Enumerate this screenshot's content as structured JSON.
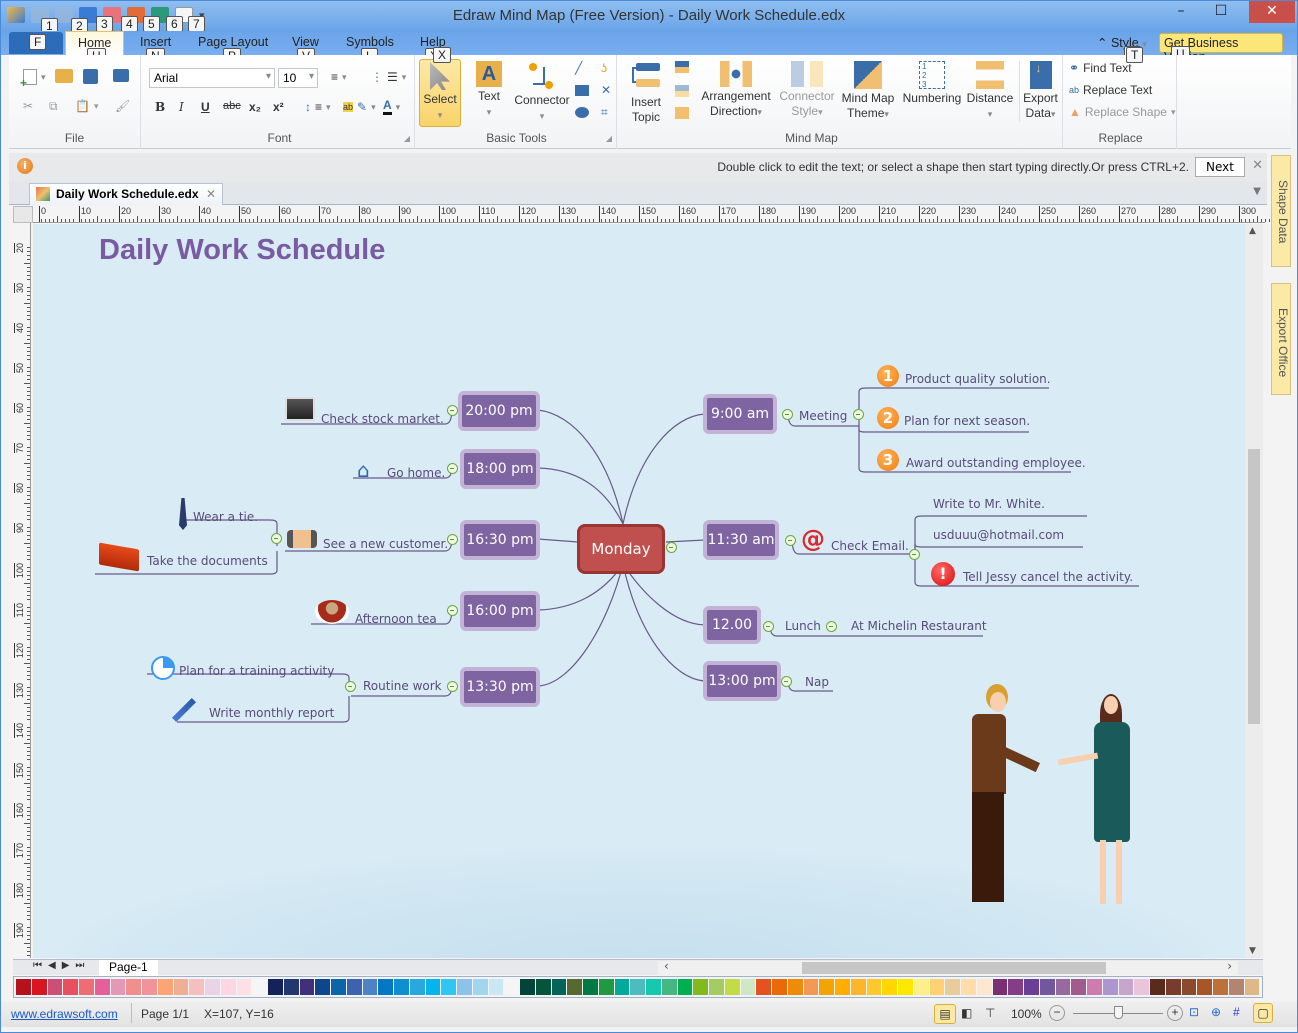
{
  "window": {
    "title": "Edraw Mind Map (Free Version) - Daily Work Schedule.edx",
    "minimize": "–",
    "maximize": "☐",
    "close": "✕"
  },
  "qat_keytips": [
    "1",
    "2",
    "3",
    "4",
    "5",
    "6",
    "7"
  ],
  "ribbon_tabs": [
    {
      "label": "F",
      "keytip": ""
    },
    {
      "label": "Home",
      "keytip": "H"
    },
    {
      "label": "Insert",
      "keytip": "N"
    },
    {
      "label": "Page Layout",
      "keytip": "P"
    },
    {
      "label": "View",
      "keytip": "V"
    },
    {
      "label": "Symbols",
      "keytip": "L"
    },
    {
      "label": "Help",
      "keytip": "X"
    }
  ],
  "style_menu": {
    "label": "Style",
    "keytip": "T"
  },
  "get_business": {
    "label": "Get Business Version...",
    "keytip": "U"
  },
  "ribbon": {
    "file_group": "File",
    "font_group": "Font",
    "font_name": "Arial",
    "font_size": "10",
    "bold": "B",
    "italic": "I",
    "underline": "U",
    "strike": "abc",
    "subscript": "x₂",
    "superscript": "x²",
    "basic_tools_group": "Basic Tools",
    "select": "Select",
    "text": "Text",
    "connector": "Connector",
    "mindmap_group": "Mind Map",
    "insert_topic": "Insert Topic",
    "arrangement": "Arrangement Direction",
    "connector_style": "Connector Style",
    "mind_map_theme": "Mind Map Theme",
    "numbering": "Numbering",
    "distance": "Distance",
    "export_data": "Export Data",
    "replace_group": "Replace",
    "find_text": "Find Text",
    "replace_text": "Replace Text",
    "replace_shape": "Replace Shape"
  },
  "message_bar": {
    "text": "Double click to edit the text; or select a shape then start typing directly.Or press CTRL+2.",
    "next": "Next"
  },
  "doc_tab": "Daily Work Schedule.edx",
  "ruler": {
    "h_ticks": [
      "0",
      "10",
      "20",
      "30",
      "40",
      "50",
      "60",
      "70",
      "80",
      "90",
      "100",
      "110",
      "120",
      "130",
      "140",
      "150",
      "160",
      "170",
      "180",
      "190",
      "200",
      "210",
      "220",
      "230",
      "240",
      "250",
      "260",
      "270",
      "280",
      "290",
      "300"
    ],
    "v_ticks": [
      "20",
      "30",
      "40",
      "50",
      "60",
      "70",
      "80",
      "90",
      "100",
      "110",
      "120",
      "130",
      "140",
      "150",
      "160",
      "170",
      "180",
      "190"
    ]
  },
  "side_panels": [
    "Shape Data",
    "Export Office"
  ],
  "mindmap": {
    "title": "Daily Work Schedule",
    "center": "Monday",
    "left_nodes": [
      {
        "time": "20:00 pm",
        "items": [
          "Check stock market."
        ]
      },
      {
        "time": "18:00 pm",
        "items": [
          "Go home."
        ]
      },
      {
        "time": "16:30 pm",
        "items": [
          "See a new customer."
        ],
        "sub": [
          "Wear a tie.",
          "Take the documents"
        ]
      },
      {
        "time": "16:00 pm",
        "items": [
          "Afternoon tea"
        ]
      },
      {
        "time": "13:30 pm",
        "items": [
          "Routine work"
        ],
        "sub": [
          "Plan for a training activity",
          "Write monthly report"
        ]
      }
    ],
    "right_nodes": [
      {
        "time": "9:00 am",
        "items": [
          "Meeting"
        ],
        "sub": [
          "Product quality solution.",
          "Plan for next season.",
          "Award outstanding employee."
        ]
      },
      {
        "time": "11:30 am",
        "items": [
          "Check Email."
        ],
        "sub": [
          "Write to Mr. White.",
          "usduuu@hotmail.com",
          "Tell Jessy cancel the activity."
        ]
      },
      {
        "time": "12.00",
        "items": [
          "Lunch",
          "At Michelin Restaurant"
        ]
      },
      {
        "time": "13:00 pm",
        "items": [
          "Nap"
        ]
      }
    ],
    "badges": [
      "1",
      "2",
      "3"
    ]
  },
  "page_tab": "Page-1",
  "palette": [
    "#b5121b",
    "#d9161f",
    "#cb4f77",
    "#e8505f",
    "#ee6c74",
    "#e4609a",
    "#e598b4",
    "#f08f8c",
    "#f1939b",
    "#fca474",
    "#f0af95",
    "#f6bfbf",
    "#ead3e6",
    "#fcd6e4",
    "#fbe0e6",
    "#f5f5f5",
    "#13225a",
    "#21376e",
    "#412f7a",
    "#0c468c",
    "#0a66a6",
    "#3c63ad",
    "#4d82c4",
    "#0676c6",
    "#0d8fd0",
    "#29a8e0",
    "#05b4ec",
    "#30c6f4",
    "#8dc3ea",
    "#a1d6ee",
    "#cae8f4",
    "#f5f5f5",
    "#03433a",
    "#05553a",
    "#046457",
    "#566a30",
    "#007a43",
    "#209a40",
    "#03a99a",
    "#4dbcbf",
    "#14c9ad",
    "#44b880",
    "#00b050",
    "#82b91c",
    "#a3cd62",
    "#c3db44",
    "#d0e7c6",
    "#e3521f",
    "#ea6a08",
    "#f08a09",
    "#f29a54",
    "#f2a500",
    "#ffae00",
    "#fbb62c",
    "#fcc92f",
    "#ffd700",
    "#ffe800",
    "#fdf08a",
    "#fed272",
    "#e8cc9c",
    "#ffdcaa",
    "#fde7ce",
    "#7a2f72",
    "#853d88",
    "#693e96",
    "#72579e",
    "#976a9f",
    "#a05c8c",
    "#cd7cb0",
    "#ab96cf",
    "#c8a6cc",
    "#ebc4dc",
    "#5a2a1c",
    "#7a3a2c",
    "#8c4a2c",
    "#a8552a",
    "#bd703a",
    "#b18570",
    "#dfb887"
  ],
  "status": {
    "link": "www.edrawsoft.com",
    "page": "Page 1/1",
    "coords": "X=107, Y=16",
    "zoom": "100%",
    "zoom_level_percent": 100
  }
}
